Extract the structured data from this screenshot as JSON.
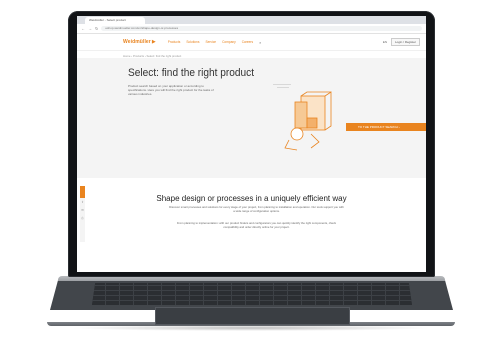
{
  "browser": {
    "tab_title": "Weidmüller - Select product",
    "url": "eshop.weidmueller.com/en/shape-design-or-processes",
    "back_icon": "arrow-left-icon",
    "forward_icon": "arrow-right-icon",
    "reload_icon": "reload-icon"
  },
  "header": {
    "logo_text": "Weidmüller",
    "logo_mark": "▶",
    "nav": [
      "Products",
      "Solutions",
      "Service",
      "Company",
      "Careers"
    ],
    "search_icon": "search-icon",
    "language": "EN",
    "cta_label": "Login / Register"
  },
  "breadcrumb": "Home  ›  Products  ›  Select: find the right product",
  "hero": {
    "title": "Select: find the right product",
    "text": "Product search based on your application or according to specifications. Here you will find the right product for the tasks of various industries.",
    "cta_label": "TO THE PRODUCT SEARCH  ›"
  },
  "side_icons": [
    "share-icon",
    "mail-icon",
    "print-icon"
  ],
  "section": {
    "title": "Shape design or processes in a uniquely efficient way",
    "para1": "Discover smart processes and solutions for every stage of your project, from planning to installation and operation. Our tools support you with a wide range of configuration options.",
    "para2": "From planning to implementation: with our product finders and configurators you can quickly identify the right components, check compatibility and order directly online for your project."
  },
  "colors": {
    "accent": "#e9841f",
    "hero_bg": "#f4f4f4",
    "bezel": "#111316",
    "body": "#42464b"
  }
}
